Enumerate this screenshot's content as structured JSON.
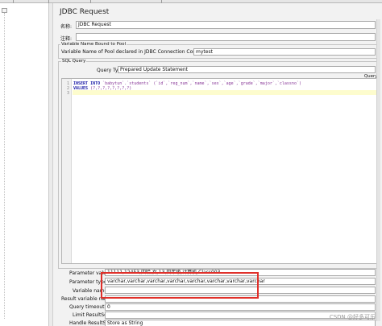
{
  "window": {
    "title": "JDBC Request"
  },
  "fields": {
    "name": {
      "label": "名称:",
      "value": "JDBC Request"
    },
    "comment": {
      "label": "注释:",
      "value": ""
    }
  },
  "pool_section": {
    "title": "Variable Name Bound to Pool",
    "variable_label": "Variable Name of Pool declared in JDBC Connection Configuration:",
    "variable_value": "mytest"
  },
  "sql_section": {
    "title": "SQL Query",
    "query_type_label": "Query Type:",
    "query_type_value": "Prepared Update Statement",
    "query_header": "Query:",
    "line_numbers": [
      "1",
      "2",
      "3"
    ],
    "lines": [
      {
        "kw": "INSERT INTO",
        "rest": " `babytun`.`students` (`id`,`reg_num`,`name`,`sex`,`age`,`grade`,`major`,`classno`)"
      },
      {
        "kw": "VALUES",
        "rest": " (?,?,?,?,?,?,?,?)"
      },
      {
        "kw": "",
        "rest": ""
      }
    ]
  },
  "parameters": {
    "values_label": "Parameter values:",
    "values_value": "11111,12453,四哈,女,13,四年级,计算机,Class003",
    "types_label": "Parameter types:",
    "types_value": "varchar,varchar,varchar,varchar,varchar,varchar,varchar,varchar",
    "variable_names_label": "Variable names:",
    "variable_names_value": "",
    "result_variable_label": "Result variable name:",
    "result_variable_value": "",
    "timeout_label": "Query timeout (s):",
    "timeout_value": "0",
    "limit_label": "Limit ResultSet:",
    "limit_value": "",
    "handle_label": "Handle ResultSet:",
    "handle_value": "Store as String"
  },
  "watermark": "CSDN @好多可乐",
  "colors": {
    "annotation_box": "#e0302a",
    "current_line": "#fdfccd",
    "keyword": "#1a1aa6"
  }
}
